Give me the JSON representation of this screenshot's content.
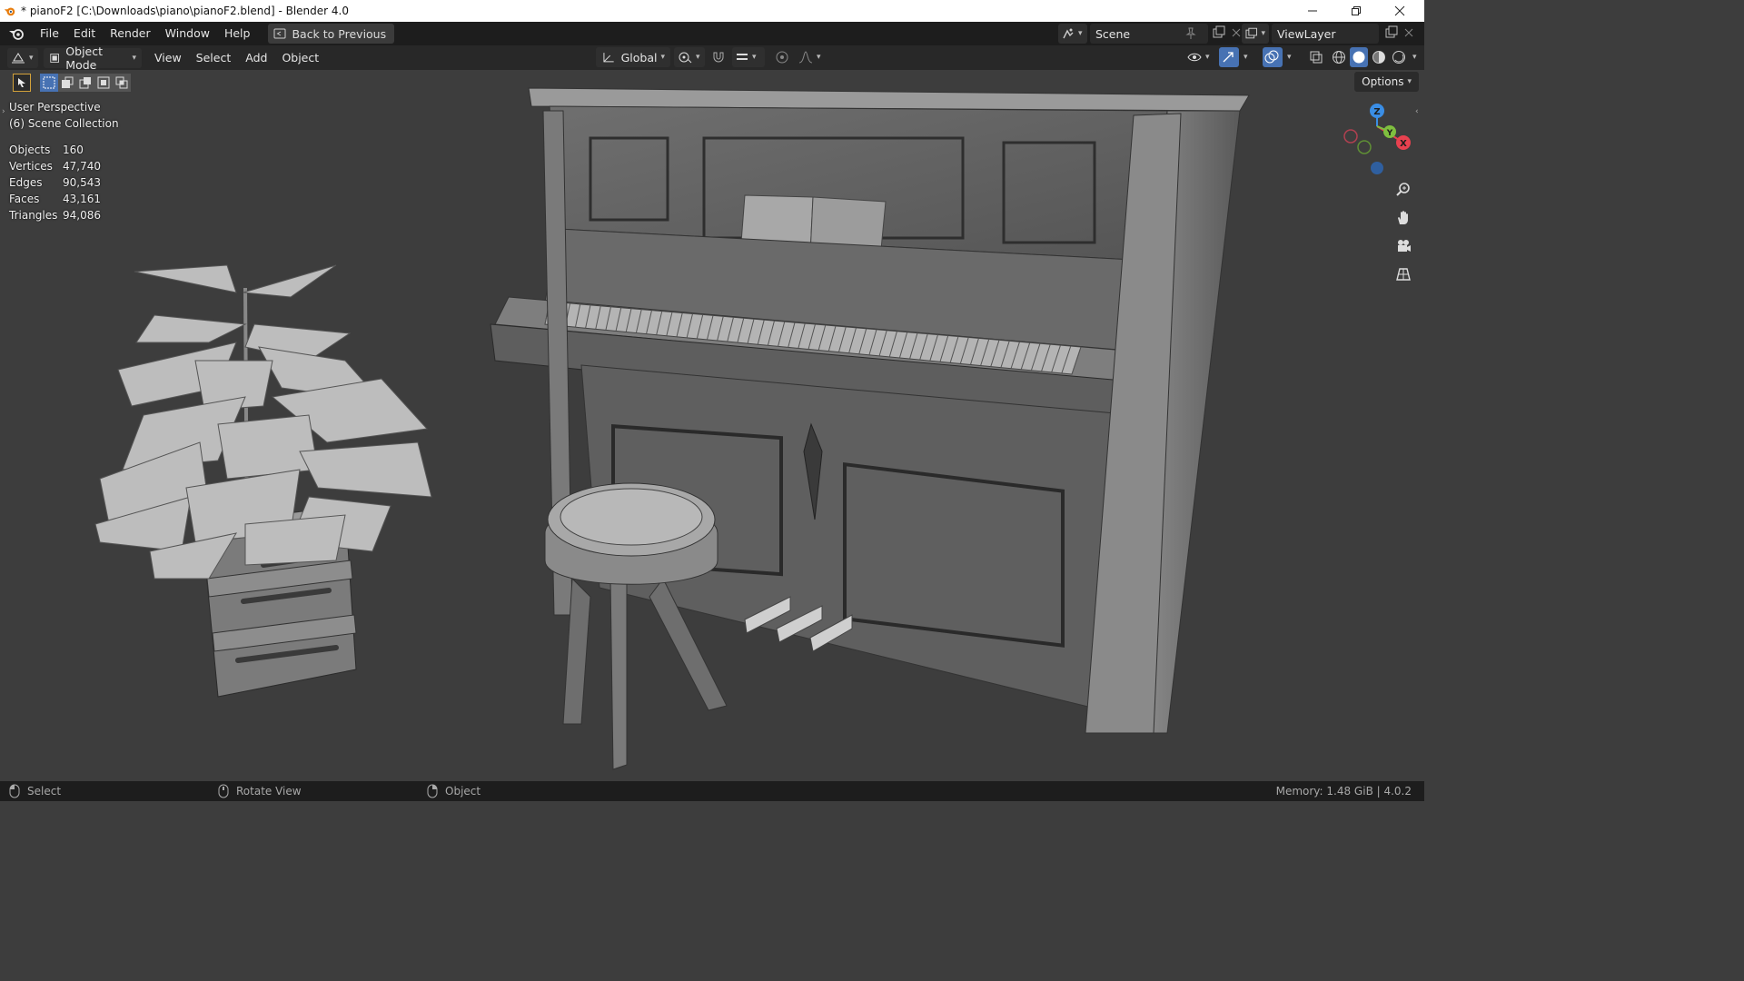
{
  "window": {
    "title": "* pianoF2 [C:\\Downloads\\piano\\pianoF2.blend] - Blender 4.0"
  },
  "menubar": {
    "items": [
      "File",
      "Edit",
      "Render",
      "Window",
      "Help"
    ],
    "back_label": "Back to Previous",
    "scene_label": "Scene",
    "viewlayer_label": "ViewLayer"
  },
  "viewport_header": {
    "mode_label": "Object Mode",
    "menus": [
      "View",
      "Select",
      "Add",
      "Object"
    ],
    "transform_orientation": "Global"
  },
  "viewport": {
    "perspective_label": "User Perspective",
    "collection_label": "(6) Scene Collection",
    "options_label": "Options",
    "stats": [
      {
        "key": "Objects",
        "value": "160"
      },
      {
        "key": "Vertices",
        "value": "47,740"
      },
      {
        "key": "Edges",
        "value": "90,543"
      },
      {
        "key": "Faces",
        "value": "43,161"
      },
      {
        "key": "Triangles",
        "value": "94,086"
      }
    ],
    "gizmo": {
      "x": "X",
      "y": "Y",
      "z": "Z"
    }
  },
  "statusbar": {
    "select_label": "Select",
    "rotate_label": "Rotate View",
    "object_label": "Object",
    "memory_label": "Memory: 1.48 GiB | 4.0.2"
  },
  "colors": {
    "accent_blue": "#4772b3",
    "gizmo_x": "#e8414f",
    "gizmo_y": "#7fbf3f",
    "gizmo_z": "#3a8ee6"
  }
}
